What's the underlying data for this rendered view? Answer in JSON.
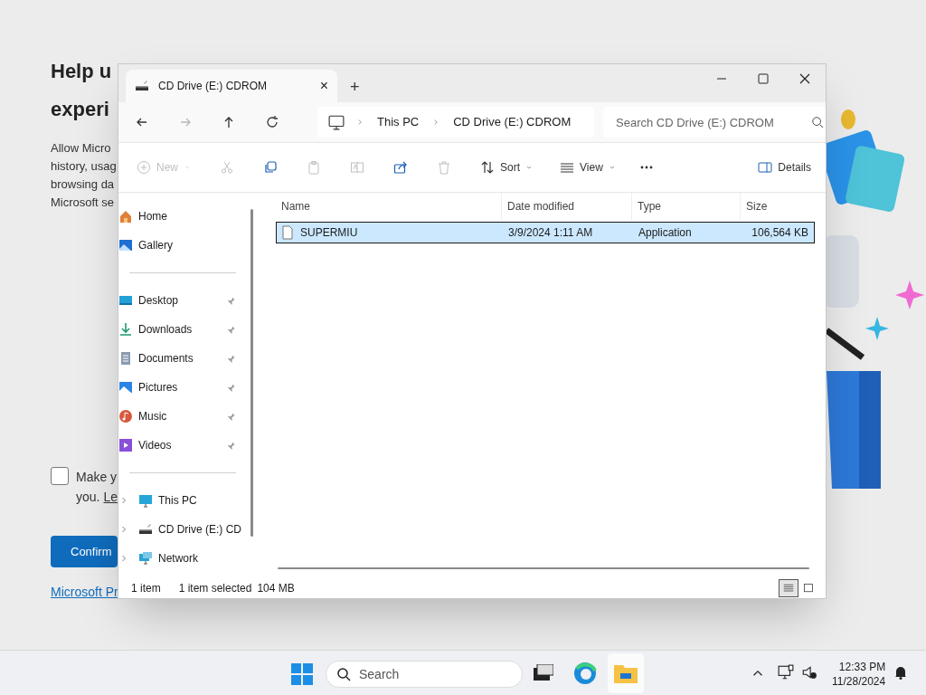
{
  "background_page": {
    "heading_lines": [
      "Help u",
      "experi"
    ],
    "body_lines": [
      "Allow Micro",
      "history, usag",
      "browsing da",
      "Microsoft se"
    ],
    "consent": {
      "checked": false,
      "line_1": "Make y",
      "line_2": "you.",
      "link": "Le"
    },
    "confirm_button": "Confirm",
    "privacy_link": "Microsoft Pr"
  },
  "window": {
    "tab": {
      "title": "CD Drive (E:) CDROM",
      "close": "×"
    },
    "new_tab": "+",
    "nav": [
      {
        "kind": "back",
        "disabled": false
      },
      {
        "kind": "forward",
        "disabled": true
      },
      {
        "kind": "up",
        "disabled": false
      },
      {
        "kind": "refresh",
        "disabled": false
      }
    ],
    "breadcrumb": [
      "This PC",
      "CD Drive (E:) CDROM"
    ],
    "search": {
      "placeholder": "Search CD Drive (E:) CDROM"
    },
    "toolbar": [
      {
        "kind": "new",
        "label": "New",
        "disabled": true
      },
      {
        "kind": "cut",
        "disabled": true
      },
      {
        "kind": "copy",
        "disabled": false
      },
      {
        "kind": "paste",
        "disabled": true
      },
      {
        "kind": "rename",
        "disabled": true
      },
      {
        "kind": "share",
        "disabled": false
      },
      {
        "kind": "delete",
        "disabled": true
      },
      {
        "kind": "sort",
        "label": "Sort",
        "disabled": false
      },
      {
        "kind": "view",
        "label": "View",
        "disabled": false
      },
      {
        "kind": "more",
        "disabled": false
      }
    ],
    "details_button": "Details",
    "sidebar": [
      [
        {
          "kind": "home",
          "label": "Home"
        },
        {
          "kind": "gallery",
          "label": "Gallery"
        }
      ],
      [
        {
          "kind": "desktop",
          "label": "Desktop",
          "pinned": true
        },
        {
          "kind": "downloads",
          "label": "Downloads",
          "pinned": true
        },
        {
          "kind": "documents",
          "label": "Documents",
          "pinned": true
        },
        {
          "kind": "pictures",
          "label": "Pictures",
          "pinned": true
        },
        {
          "kind": "music",
          "label": "Music",
          "pinned": true
        },
        {
          "kind": "videos",
          "label": "Videos",
          "pinned": true
        }
      ],
      [
        {
          "kind": "pc",
          "label": "This PC",
          "expanded": false
        },
        {
          "kind": "drive",
          "label": "CD Drive (E:) CD",
          "expanded": false
        },
        {
          "kind": "network",
          "label": "Network",
          "expanded": false
        }
      ]
    ],
    "columns": [
      "Name",
      "Date modified",
      "Type",
      "Size"
    ],
    "rows": [
      {
        "name": "SUPERMIU",
        "date": "3/9/2024 1:11 AM",
        "type": "Application",
        "size": "106,564 KB",
        "selected": true
      }
    ],
    "status": {
      "count": "1 item",
      "selection": "1 item selected",
      "size": "104 MB"
    },
    "view_modes": [
      {
        "kind": "details",
        "selected": true
      },
      {
        "kind": "tiles",
        "selected": false
      }
    ]
  },
  "taskbar": {
    "search_placeholder": "Search",
    "time": "12:33 PM",
    "date": "11/28/2024"
  }
}
